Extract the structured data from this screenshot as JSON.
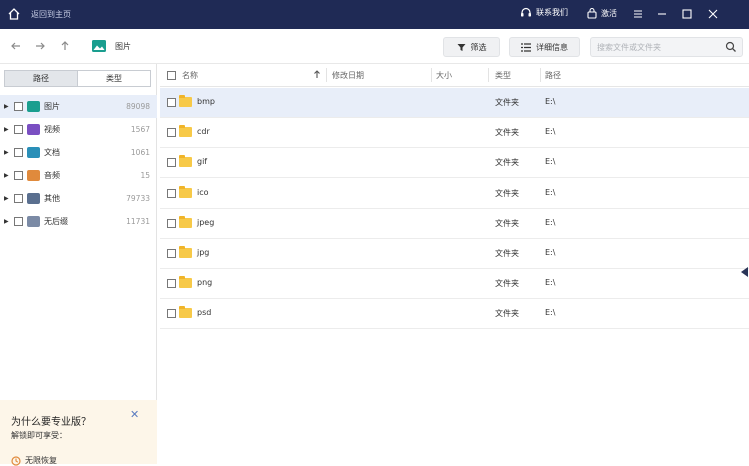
{
  "titlebar": {
    "back_label": "返回到主页",
    "contact_label": "联系我们",
    "activate_label": "激活"
  },
  "toolbar": {
    "crumb_label": "图片",
    "filter_label": "筛选",
    "detail_label": "详细信息",
    "search_placeholder": "搜索文件或文件夹"
  },
  "sidebar": {
    "tabs": [
      {
        "label": "路径",
        "active": true
      },
      {
        "label": "类型",
        "active": false
      }
    ],
    "items": [
      {
        "label": "图片",
        "count": "89098",
        "icon": "image-icon",
        "color": "#1a9e8f",
        "selected": true
      },
      {
        "label": "视频",
        "count": "1567",
        "icon": "video-icon",
        "color": "#7a4fc2",
        "selected": false
      },
      {
        "label": "文档",
        "count": "1061",
        "icon": "document-icon",
        "color": "#2a8fb8",
        "selected": false
      },
      {
        "label": "音频",
        "count": "15",
        "icon": "audio-icon",
        "color": "#e08a3c",
        "selected": false
      },
      {
        "label": "其他",
        "count": "79733",
        "icon": "other-icon",
        "color": "#5a6f8f",
        "selected": false
      },
      {
        "label": "无后缀",
        "count": "11731",
        "icon": "no-extension-icon",
        "color": "#7b8aa5",
        "selected": false
      }
    ]
  },
  "table": {
    "columns": {
      "name": "名称",
      "modified": "修改日期",
      "size": "大小",
      "type": "类型",
      "path": "路径"
    },
    "rows": [
      {
        "name": "bmp",
        "type": "文件夹",
        "path": "E:\\",
        "selected": true
      },
      {
        "name": "cdr",
        "type": "文件夹",
        "path": "E:\\",
        "selected": false
      },
      {
        "name": "gif",
        "type": "文件夹",
        "path": "E:\\",
        "selected": false
      },
      {
        "name": "ico",
        "type": "文件夹",
        "path": "E:\\",
        "selected": false
      },
      {
        "name": "jpeg",
        "type": "文件夹",
        "path": "E:\\",
        "selected": false
      },
      {
        "name": "jpg",
        "type": "文件夹",
        "path": "E:\\",
        "selected": false
      },
      {
        "name": "png",
        "type": "文件夹",
        "path": "E:\\",
        "selected": false
      },
      {
        "name": "psd",
        "type": "文件夹",
        "path": "E:\\",
        "selected": false
      }
    ]
  },
  "promo": {
    "title": "为什么要专业版？",
    "subtitle": "解锁即可享受：",
    "item": "无限恢复"
  },
  "colors": {
    "titlebar_bg": "#1f2a55",
    "selection_bg": "#e8eef9",
    "folder": "#f7c948",
    "promo_bg": "#fdf6e9"
  }
}
